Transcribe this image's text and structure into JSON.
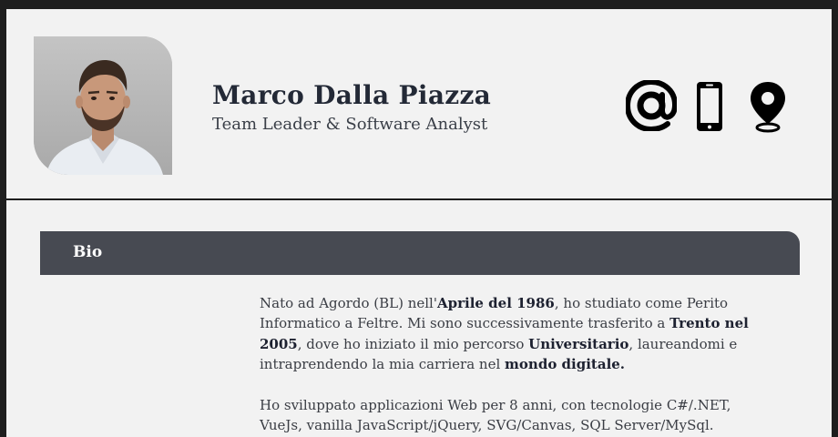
{
  "header": {
    "name": "Marco Dalla Piazza",
    "role": "Team Leader & Software Analyst",
    "contacts": [
      {
        "icon": "at-icon",
        "label": "email"
      },
      {
        "icon": "smartphone-icon",
        "label": "phone"
      },
      {
        "icon": "location-pin-icon",
        "label": "location"
      }
    ]
  },
  "sections": [
    {
      "title": "Bio",
      "paragraphs": [
        [
          {
            "text": "Nato ad Agordo (BL) nell'",
            "bold": false
          },
          {
            "text": "Aprile del 1986",
            "bold": true
          },
          {
            "text": ", ho studiato come Perito Informatico a Feltre. Mi sono successivamente trasferito a ",
            "bold": false
          },
          {
            "text": "Trento nel 2005",
            "bold": true
          },
          {
            "text": ", dove ho iniziato il mio percorso ",
            "bold": false
          },
          {
            "text": "Universitario",
            "bold": true
          },
          {
            "text": ", laureandomi e intraprendendo la mia carriera nel ",
            "bold": false
          },
          {
            "text": "mondo digitale.",
            "bold": true
          }
        ],
        [
          {
            "text": "Ho sviluppato applicazioni Web per 8 anni, con tecnologie C#/.NET, VueJs, vanilla JavaScript/jQuery, SVG/Canvas, SQL Server/MySql.",
            "bold": false
          }
        ]
      ]
    }
  ],
  "colors": {
    "page_background": "#f2f2f2",
    "outer_border": "#1e1e1e",
    "section_bar": "#474a52",
    "heading_text": "#232936"
  }
}
